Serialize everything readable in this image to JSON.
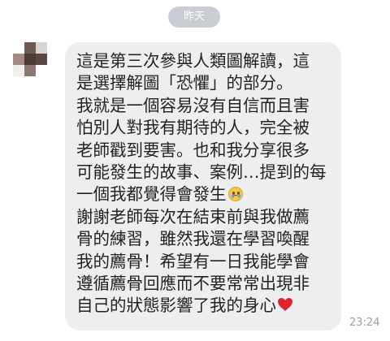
{
  "date_divider": "昨天",
  "message": {
    "lines": [
      "這是第三次參與人類圖解讀，這",
      "是選擇解圖「恐懼」的部分。",
      "我就是一個容易沒有自信而且害",
      "怕別人對我有期待的人，完全被",
      "老師戳到要害。也和我分享很多",
      "可能發生的故事、案例…提到的每",
      "一個我都覺得會發生",
      "謝謝老師每次在結束前與我做薦",
      "骨的練習，雖然我還在學習喚醒",
      "我的薦骨！希望有一日我能學會",
      "遵循薦骨回應而不要常常出現非",
      "自己的狀態影響了我的身心"
    ],
    "emoji_after_line_7": "crying-face-icon",
    "emoji_after_line_12": "heart-icon",
    "time": "23:24"
  },
  "colors": {
    "bubble": "#eceef0",
    "date_pill": "#c9cdd3",
    "text": "#222222",
    "timestamp": "#9a9ea4",
    "heart": "#e0242f"
  }
}
